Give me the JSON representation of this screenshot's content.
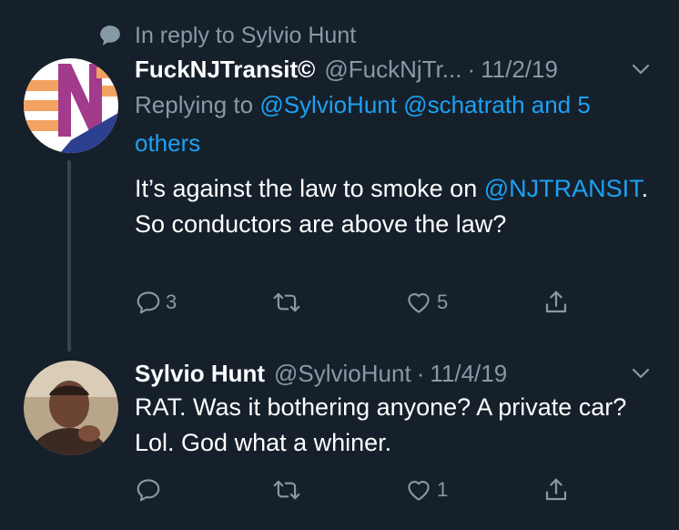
{
  "context": {
    "text": "In reply to Sylvio Hunt",
    "icon": "speech-bubble-icon"
  },
  "tweets": [
    {
      "name": "FuckNJTransit©",
      "handle": "@FuckNjTr...",
      "separator": "·",
      "date": "11/2/19",
      "replying_label": "Replying to",
      "replying_mentions": "@SylvioHunt @schatrath and 5 others",
      "body_mention": "@NJTRANSIT",
      "body_before": "It’s against the law to smoke on ",
      "body_after": ". So conductors are above the law?",
      "reply_count": "3",
      "retweet_count": "",
      "like_count": "5",
      "avatar_colors": [
        "#ffffff",
        "#f4a261",
        "#a23b8c",
        "#2d3f8f"
      ]
    },
    {
      "name": "Sylvio Hunt",
      "handle": "@SylvioHunt",
      "separator": "·",
      "date": "11/4/19",
      "body": "RAT. Was it bothering anyone? A private car? Lol. God what a whiner.",
      "reply_count": "",
      "retweet_count": "",
      "like_count": "1"
    }
  ],
  "colors": {
    "background": "#15202b",
    "secondary": "#8899a6",
    "link": "#1da1f2",
    "thread_line": "#38444d"
  }
}
